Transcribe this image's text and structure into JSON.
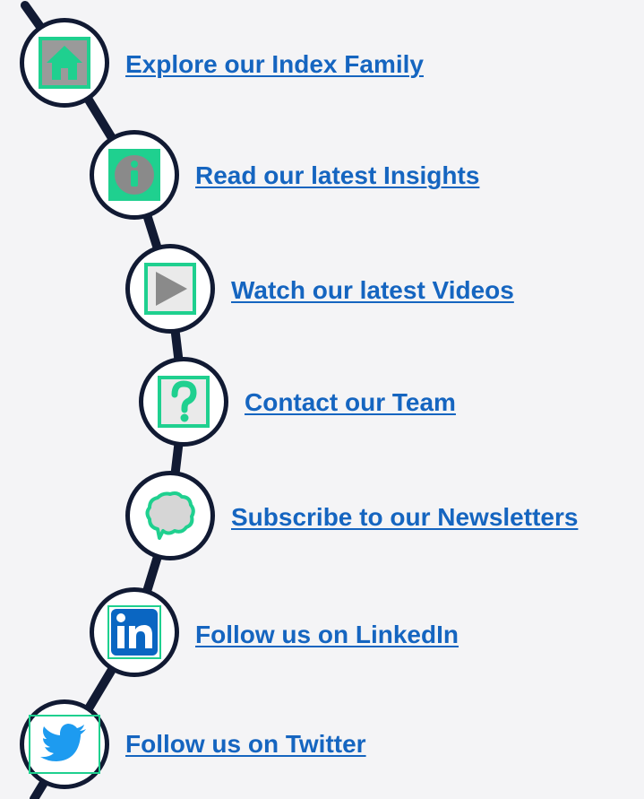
{
  "colors": {
    "spine": "#111a33",
    "link": "#1565c0",
    "icon_green": "#1fd08f",
    "icon_gray": "#9a9a9a",
    "twitter_blue": "#1d9bf0",
    "linkedin_blue": "#0a66c2",
    "background": "#f4f4f6"
  },
  "items": [
    {
      "id": "index-family",
      "label": "Explore our Index Family",
      "icon": "home-icon"
    },
    {
      "id": "insights",
      "label": "Read our latest Insights",
      "icon": "info-icon"
    },
    {
      "id": "videos",
      "label": "Watch our latest Videos",
      "icon": "play-icon"
    },
    {
      "id": "contact",
      "label": "Contact our Team",
      "icon": "question-icon"
    },
    {
      "id": "newsletters",
      "label": "Subscribe to our Newsletters",
      "icon": "speech-bubble-icon"
    },
    {
      "id": "linkedin",
      "label": "Follow us on LinkedIn",
      "icon": "linkedin-icon"
    },
    {
      "id": "twitter",
      "label": "Follow us on Twitter",
      "icon": "twitter-icon"
    }
  ]
}
